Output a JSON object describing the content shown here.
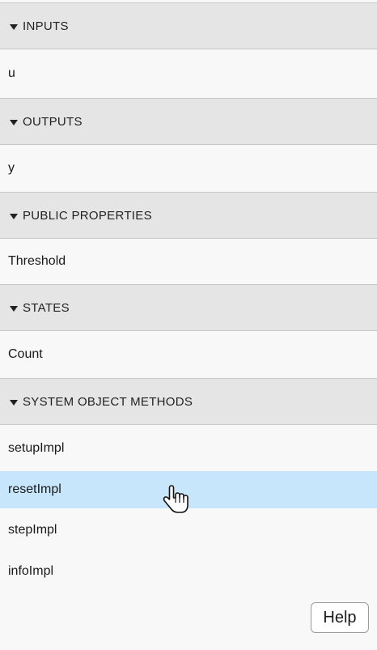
{
  "sections": [
    {
      "header": "INPUTS",
      "items": [
        "u"
      ]
    },
    {
      "header": "OUTPUTS",
      "items": [
        "y"
      ]
    },
    {
      "header": "PUBLIC PROPERTIES",
      "items": [
        "Threshold"
      ]
    },
    {
      "header": "STATES",
      "items": [
        "Count"
      ]
    },
    {
      "header": "SYSTEM OBJECT METHODS",
      "items": [
        "setupImpl",
        "resetImpl",
        "stepImpl",
        "infoImpl"
      ]
    }
  ],
  "selected_item": "resetImpl",
  "help_label": "Help",
  "icons": {
    "section_toggle": "caret-down-icon",
    "cursor": "hand-pointer-icon"
  },
  "colors": {
    "header_bg": "#e5e5e5",
    "selected_bg": "#c7e6fb",
    "panel_bg": "#f8f8f8"
  }
}
